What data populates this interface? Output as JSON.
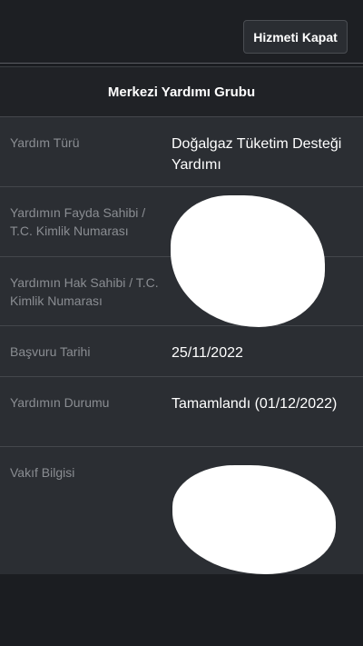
{
  "header": {
    "close_button": "Hizmeti Kapat"
  },
  "panel": {
    "title": "Merkezi Yardımı Grubu",
    "rows": [
      {
        "label": "Yardım Türü",
        "value": "Doğalgaz Tüketim Desteği Yardımı"
      },
      {
        "label": "Yardımın Fayda Sahibi / T.C. Kimlik Numarası",
        "value": ""
      },
      {
        "label": "Yardımın Hak Sahibi / T.C. Kimlik Numarası",
        "value": ""
      },
      {
        "label": "Başvuru Tarihi",
        "value": "25/11/2022"
      },
      {
        "label": "Yardımın Durumu",
        "value": "Tamamlandı (01/12/2022)"
      },
      {
        "label": "Vakıf Bilgisi",
        "value": ""
      }
    ]
  }
}
